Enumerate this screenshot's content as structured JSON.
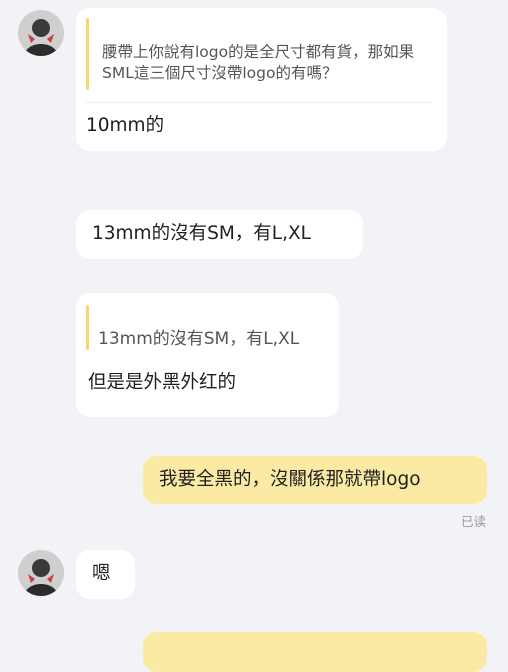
{
  "messages": [
    {
      "quote": "腰帶上你說有logo的是全尺寸都有貨，那如果SML這三個尺寸沒帶logo的有嗎？",
      "text": "10mm的"
    },
    {
      "text": "13mm的沒有SM，有L,XL"
    },
    {
      "quote": "13mm的沒有SM，有L,XL",
      "text": "但是是外黑外红的"
    },
    {
      "text": "我要全黑的，沒關係那就帶logo",
      "status": "已读"
    },
    {
      "text": "嗯"
    }
  ],
  "colors": {
    "background": "#f2f2f7",
    "received_bubble": "#ffffff",
    "sent_bubble": "#fbeaa3",
    "quote_bar": "#f5d76e"
  },
  "icons": {
    "avatar": "avatar-image"
  }
}
